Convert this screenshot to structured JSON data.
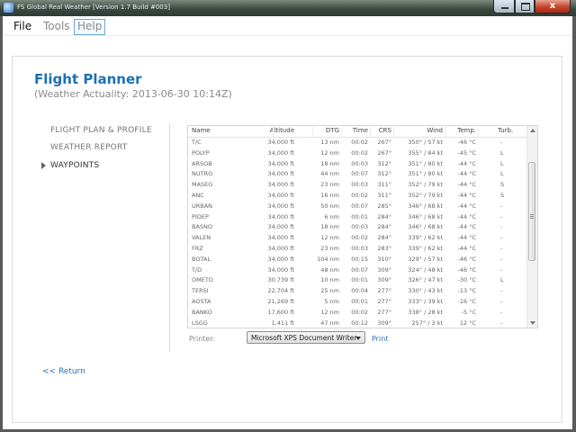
{
  "window": {
    "title": "FS Global Real Weather [Version 1.7 Build #003]",
    "close_label": "x"
  },
  "menu": {
    "file": "File",
    "tools": "Tools",
    "help": "Help"
  },
  "page": {
    "heading": "Flight Planner",
    "subheading": "(Weather Actuality: 2013-06-30 10:14Z)"
  },
  "nav": {
    "items": [
      "FLIGHT PLAN & PROFILE",
      "WEATHER REPORT",
      "WAYPOINTS"
    ]
  },
  "table": {
    "columns": [
      "Name",
      "Altitude",
      "DTG",
      "Time",
      "CRS",
      "Wind",
      "Temp.",
      "Turb."
    ],
    "rows": [
      [
        "T/C",
        "34,000 ft",
        "13 nm",
        "00:02",
        "267°",
        "350° / 57 kt",
        "-46 °C",
        "-"
      ],
      [
        "POLYP",
        "34,000 ft",
        "12 nm",
        "00:02",
        "267°",
        "355° / 84 kt",
        "-45 °C",
        "L"
      ],
      [
        "ARSOB",
        "34,000 ft",
        "18 nm",
        "00:03",
        "312°",
        "351° / 80 kt",
        "-44 °C",
        "L"
      ],
      [
        "NUTRO",
        "34,000 ft",
        "44 nm",
        "00:07",
        "312°",
        "351° / 80 kt",
        "-44 °C",
        "L"
      ],
      [
        "MASEG",
        "34,000 ft",
        "23 nm",
        "00:03",
        "311°",
        "352° / 79 kt",
        "-44 °C",
        "S"
      ],
      [
        "ANC",
        "34,000 ft",
        "16 nm",
        "00:02",
        "311°",
        "352° / 79 kt",
        "-44 °C",
        "S"
      ],
      [
        "URBAN",
        "34,000 ft",
        "50 nm",
        "00:07",
        "285°",
        "346° / 68 kt",
        "-44 °C",
        "-"
      ],
      [
        "PIDEP",
        "34,000 ft",
        "6 nm",
        "00:01",
        "284°",
        "346° / 68 kt",
        "-44 °C",
        "-"
      ],
      [
        "BASNO",
        "34,000 ft",
        "18 nm",
        "00:03",
        "284°",
        "346° / 68 kt",
        "-44 °C",
        "-"
      ],
      [
        "VALEN",
        "34,000 ft",
        "12 nm",
        "00:02",
        "284°",
        "339° / 62 kt",
        "-44 °C",
        "-"
      ],
      [
        "FRZ",
        "34,000 ft",
        "23 nm",
        "00:03",
        "283°",
        "339° / 62 kt",
        "-44 °C",
        "-"
      ],
      [
        "BOTAL",
        "34,000 ft",
        "104 nm",
        "00:15",
        "310°",
        "329° / 57 kt",
        "-46 °C",
        "-"
      ],
      [
        "T/D",
        "34,000 ft",
        "48 nm",
        "00:07",
        "309°",
        "324° / 48 kt",
        "-46 °C",
        "-"
      ],
      [
        "OMETO",
        "30,739 ft",
        "10 nm",
        "00:01",
        "309°",
        "326° / 47 kt",
        "-30 °C",
        "L"
      ],
      [
        "TERSI",
        "22,704 ft",
        "25 nm",
        "00:04",
        "277°",
        "330° / 43 kt",
        "-13 °C",
        "-"
      ],
      [
        "AOSTA",
        "21,269 ft",
        "5 nm",
        "00:01",
        "277°",
        "333° / 39 kt",
        "-16 °C",
        "-"
      ],
      [
        "BANKO",
        "17,600 ft",
        "12 nm",
        "00:02",
        "277°",
        "338° / 28 kt",
        "-5 °C",
        "-"
      ],
      [
        "LSGG",
        "1,411 ft",
        "47 nm",
        "00:12",
        "309°",
        "257° / 3 kt",
        "12 °C",
        "-"
      ]
    ]
  },
  "printer": {
    "label": "Printer:",
    "selected": "Microsoft XPS Document Writer",
    "print_label": "Print"
  },
  "return_label": "<< Return"
}
